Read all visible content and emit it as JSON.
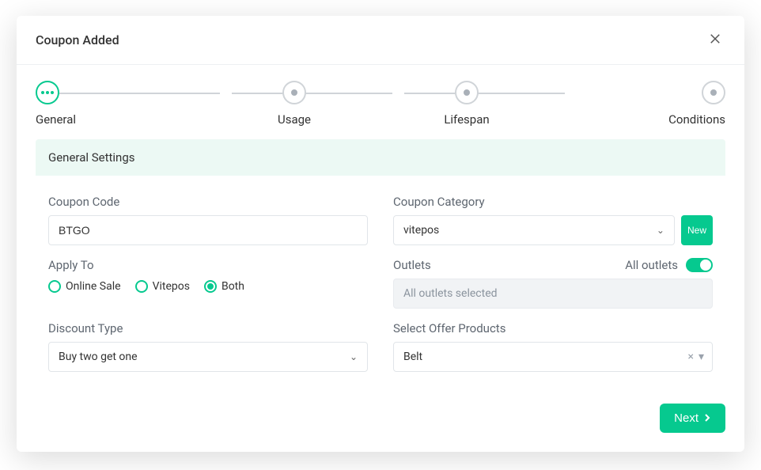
{
  "header": {
    "title": "Coupon Added"
  },
  "stepper": {
    "steps": [
      "General",
      "Usage",
      "Lifespan",
      "Conditions"
    ],
    "active_index": 0
  },
  "section": {
    "title": "General Settings"
  },
  "fields": {
    "coupon_code": {
      "label": "Coupon Code",
      "value": "BTGO"
    },
    "coupon_category": {
      "label": "Coupon Category",
      "value": "vitepos",
      "new_label": "New"
    },
    "apply_to": {
      "label": "Apply To",
      "options": [
        "Online Sale",
        "Vitepos",
        "Both"
      ],
      "selected": "Both"
    },
    "outlets": {
      "label": "Outlets",
      "all_label": "All outlets",
      "all_selected": true,
      "display": "All outlets selected"
    },
    "discount_type": {
      "label": "Discount Type",
      "value": "Buy two get one"
    },
    "select_products": {
      "label": "Select Offer Products",
      "value": "Belt"
    }
  },
  "footer": {
    "next": "Next"
  },
  "colors": {
    "accent": "#06c98f"
  }
}
